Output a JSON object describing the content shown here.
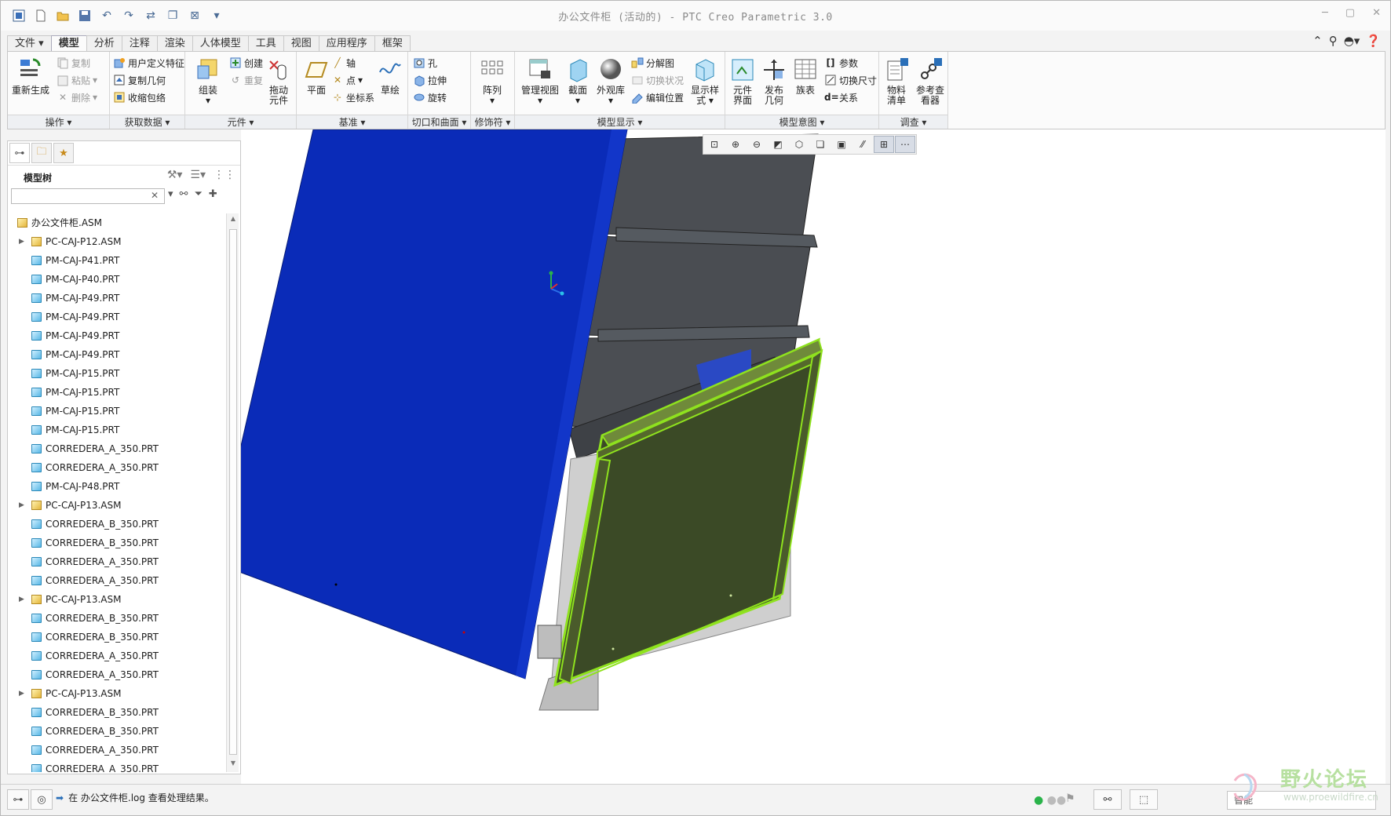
{
  "app": {
    "window_title": "办公文件柜 (活动的) - PTC Creo Parametric 3.0"
  },
  "tabs": [
    "文件",
    "模型",
    "分析",
    "注释",
    "渲染",
    "人体模型",
    "工具",
    "视图",
    "应用程序",
    "框架"
  ],
  "ribbon": {
    "groups": {
      "operations": "操作",
      "get_data": "获取数据",
      "component": "元件",
      "datum": "基准",
      "cut_surface": "切口和曲面",
      "modifiers": "修饰符",
      "model_display": "模型显示",
      "model_intent": "模型意图",
      "investigate": "调查"
    },
    "buttons": {
      "regenerate": "重新生成",
      "copy": "复制",
      "paste": "粘贴",
      "delete": "删除",
      "user_feature": "用户定义特征",
      "copy_geometry": "复制几何",
      "shrinkwrap": "收缩包络",
      "assemble": "组装",
      "create": "创建",
      "repeat": "重复",
      "drag_component_1": "拖动",
      "drag_component_2": "元件",
      "plane": "平面",
      "axis": "轴",
      "point": "点",
      "csys": "坐标系",
      "sketch": "草绘",
      "hole": "孔",
      "extrude": "拉伸",
      "revolve": "旋转",
      "pattern": "阵列",
      "manage_views": "管理视图",
      "section": "截面",
      "appearance": "外观库",
      "explode": "分解图",
      "toggle_status": "切换状况",
      "edit_position": "编辑位置",
      "display_style_1": "显示样",
      "display_style_2": "式",
      "comp_interface_1": "元件",
      "comp_interface_2": "界面",
      "publish_geom_1": "发布",
      "publish_geom_2": "几何",
      "family_table": "族表",
      "parameters": "参数",
      "switch_dims": "切换尺寸",
      "relations": "关系",
      "bom_1": "物料",
      "bom_2": "清单",
      "ref_viewer_1": "参考查",
      "ref_viewer_2": "看器"
    }
  },
  "model_tree": {
    "title": "模型树",
    "search_value": "",
    "nodes": [
      {
        "name": "办公文件柜.ASM",
        "kind": "asm",
        "level": 0,
        "expander": ""
      },
      {
        "name": "PC-CAJ-P12.ASM",
        "kind": "asm",
        "level": 1,
        "expander": "▶"
      },
      {
        "name": "PM-CAJ-P41.PRT",
        "kind": "part",
        "level": 1,
        "expander": ""
      },
      {
        "name": "PM-CAJ-P40.PRT",
        "kind": "part",
        "level": 1,
        "expander": ""
      },
      {
        "name": "PM-CAJ-P49.PRT",
        "kind": "part",
        "level": 1,
        "expander": ""
      },
      {
        "name": "PM-CAJ-P49.PRT",
        "kind": "part",
        "level": 1,
        "expander": ""
      },
      {
        "name": "PM-CAJ-P49.PRT",
        "kind": "part",
        "level": 1,
        "expander": ""
      },
      {
        "name": "PM-CAJ-P49.PRT",
        "kind": "part",
        "level": 1,
        "expander": ""
      },
      {
        "name": "PM-CAJ-P15.PRT",
        "kind": "part",
        "level": 1,
        "expander": ""
      },
      {
        "name": "PM-CAJ-P15.PRT",
        "kind": "part",
        "level": 1,
        "expander": ""
      },
      {
        "name": "PM-CAJ-P15.PRT",
        "kind": "part",
        "level": 1,
        "expander": ""
      },
      {
        "name": "PM-CAJ-P15.PRT",
        "kind": "part",
        "level": 1,
        "expander": ""
      },
      {
        "name": "CORREDERA_A_350.PRT",
        "kind": "part",
        "level": 1,
        "expander": ""
      },
      {
        "name": "CORREDERA_A_350.PRT",
        "kind": "part",
        "level": 1,
        "expander": ""
      },
      {
        "name": "PM-CAJ-P48.PRT",
        "kind": "part",
        "level": 1,
        "expander": ""
      },
      {
        "name": "PC-CAJ-P13.ASM",
        "kind": "asm",
        "level": 1,
        "expander": "▶"
      },
      {
        "name": "CORREDERA_B_350.PRT",
        "kind": "part",
        "level": 1,
        "expander": ""
      },
      {
        "name": "CORREDERA_B_350.PRT",
        "kind": "part",
        "level": 1,
        "expander": ""
      },
      {
        "name": "CORREDERA_A_350.PRT",
        "kind": "part",
        "level": 1,
        "expander": ""
      },
      {
        "name": "CORREDERA_A_350.PRT",
        "kind": "part",
        "level": 1,
        "expander": ""
      },
      {
        "name": "PC-CAJ-P13.ASM",
        "kind": "asm",
        "level": 1,
        "expander": "▶"
      },
      {
        "name": "CORREDERA_B_350.PRT",
        "kind": "part",
        "level": 1,
        "expander": ""
      },
      {
        "name": "CORREDERA_B_350.PRT",
        "kind": "part",
        "level": 1,
        "expander": ""
      },
      {
        "name": "CORREDERA_A_350.PRT",
        "kind": "part",
        "level": 1,
        "expander": ""
      },
      {
        "name": "CORREDERA_A_350.PRT",
        "kind": "part",
        "level": 1,
        "expander": ""
      },
      {
        "name": "PC-CAJ-P13.ASM",
        "kind": "asm",
        "level": 1,
        "expander": "▶"
      },
      {
        "name": "CORREDERA_B_350.PRT",
        "kind": "part",
        "level": 1,
        "expander": ""
      },
      {
        "name": "CORREDERA_B_350.PRT",
        "kind": "part",
        "level": 1,
        "expander": ""
      },
      {
        "name": "CORREDERA_A_350.PRT",
        "kind": "part",
        "level": 1,
        "expander": ""
      },
      {
        "name": "CORREDERA_A_350.PRT",
        "kind": "part",
        "level": 1,
        "expander": ""
      }
    ]
  },
  "status": {
    "message": "在 办公文件柜.log 查看处理结果。",
    "filter": "智能"
  },
  "watermark": {
    "text": "野火论坛",
    "url": "www.proewildfire.cn"
  },
  "colors": {
    "cabinet_side": "#0a2bb8",
    "drawer_highlight": "#8fe21e",
    "drawer_fill": "#3b4a26",
    "drawer_gray": "#4b4e53"
  }
}
